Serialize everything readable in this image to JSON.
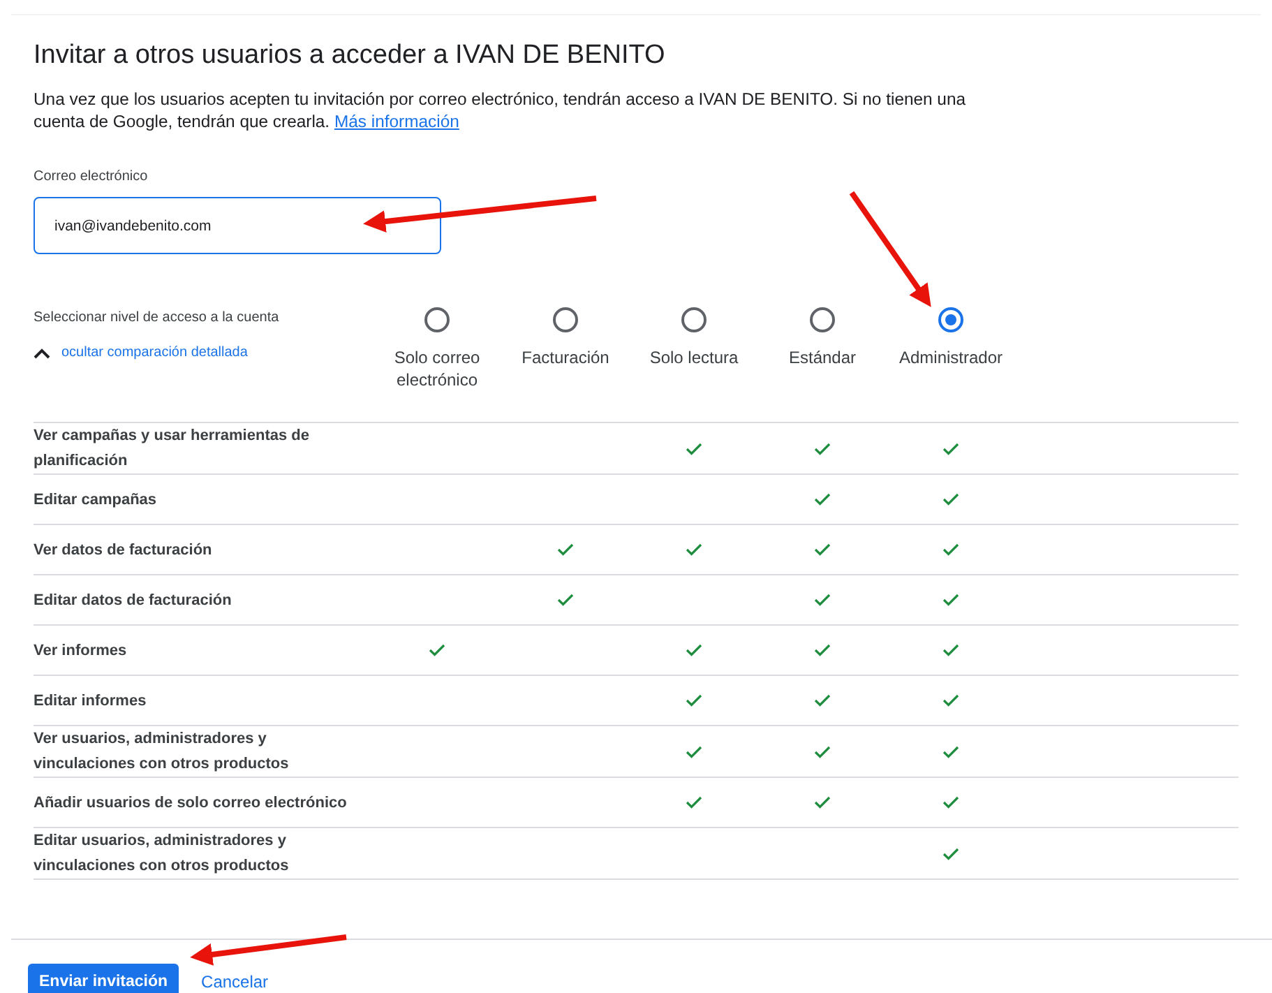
{
  "title": "Invitar a otros usuarios a acceder a IVAN DE BENITO",
  "description": {
    "text": "Una vez que los usuarios acepten tu invitación por correo electrónico, tendrán acceso a IVAN DE BENITO. Si no tienen una cuenta de Google, tendrán que crearla.",
    "link": "Más información"
  },
  "email": {
    "label": "Correo electrónico",
    "value": "ivan@ivandebenito.com"
  },
  "access": {
    "label": "Seleccionar nivel de acceso a la cuenta",
    "toggle": {
      "text": "ocultar comparación detallada",
      "expanded": true
    },
    "levels": [
      {
        "label": "Solo correo electrónico",
        "selected": false
      },
      {
        "label": "Facturación",
        "selected": false
      },
      {
        "label": "Solo lectura",
        "selected": false
      },
      {
        "label": "Estándar",
        "selected": false
      },
      {
        "label": "Administrador",
        "selected": true
      }
    ]
  },
  "permissions": [
    {
      "label": "Ver campañas y usar herramientas de planificación",
      "allowed": [
        false,
        false,
        true,
        true,
        true
      ]
    },
    {
      "label": "Editar campañas",
      "allowed": [
        false,
        false,
        false,
        true,
        true
      ]
    },
    {
      "label": "Ver datos de facturación",
      "allowed": [
        false,
        true,
        true,
        true,
        true
      ]
    },
    {
      "label": "Editar datos de facturación",
      "allowed": [
        false,
        true,
        false,
        true,
        true
      ]
    },
    {
      "label": "Ver informes",
      "allowed": [
        true,
        false,
        true,
        true,
        true
      ]
    },
    {
      "label": "Editar informes",
      "allowed": [
        false,
        false,
        true,
        true,
        true
      ]
    },
    {
      "label": "Ver usuarios, administradores y vinculaciones con otros productos",
      "allowed": [
        false,
        false,
        true,
        true,
        true
      ]
    },
    {
      "label": "Añadir usuarios de solo correo electrónico",
      "allowed": [
        false,
        false,
        true,
        true,
        true
      ]
    },
    {
      "label": "Editar usuarios, administradores y vinculaciones con otros productos",
      "allowed": [
        false,
        false,
        false,
        false,
        true
      ]
    }
  ],
  "buttons": [
    {
      "kind": "primary",
      "label": "Enviar invitación"
    },
    {
      "kind": "text",
      "label": "Cancelar"
    }
  ]
}
